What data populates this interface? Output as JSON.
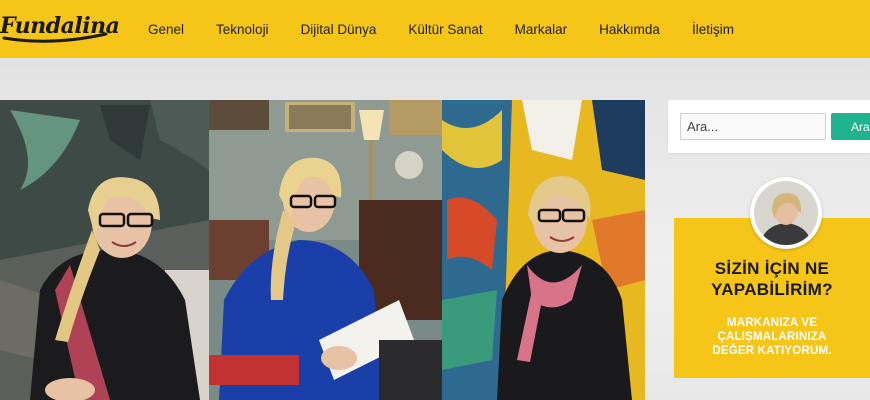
{
  "site": {
    "logo_text": "Fundalina"
  },
  "nav": {
    "items": [
      {
        "label": "Genel"
      },
      {
        "label": "Teknoloji"
      },
      {
        "label": "Dijital Dünya"
      },
      {
        "label": "Kültür Sanat"
      },
      {
        "label": "Markalar"
      },
      {
        "label": "Hakkımda"
      },
      {
        "label": "İletişim"
      }
    ]
  },
  "search": {
    "placeholder": "Ara...",
    "button_label": "Ara"
  },
  "promo": {
    "title_line1": "SİZİN İÇİN NE",
    "title_line2": "YAPABİLİRİM?",
    "sub_line1": "MARKANIZA VE",
    "sub_line2": "ÇALIŞMALARINIZA",
    "sub_line3": "DEĞER KATIYORUM."
  },
  "colors": {
    "brand_yellow": "#f5c518",
    "search_button": "#1fb38f"
  }
}
